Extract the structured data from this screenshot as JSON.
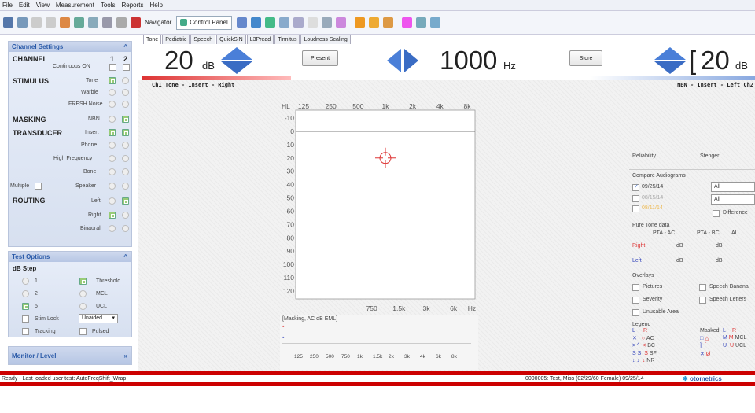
{
  "menu": [
    "File",
    "Edit",
    "View",
    "Measurement",
    "Tools",
    "Reports",
    "Help"
  ],
  "toolbar": {
    "navigator_label": "Navigator",
    "control_panel_label": "Control Panel"
  },
  "tabs": [
    "Tone",
    "Pediatric",
    "Speech",
    "QuickSIN",
    "L3Pread",
    "Tinnitus",
    "Loudness Scaling"
  ],
  "channel_settings": {
    "title": "Channel Settings",
    "channel_label": "CHANNEL",
    "ch1": "1",
    "ch2": "2",
    "continuous_on": "Continuous ON",
    "stimulus_label": "STIMULUS",
    "tone": "Tone",
    "warble": "Warble",
    "fresh_noise": "FRESH Noise",
    "masking_label": "MASKING",
    "nbn": "NBN",
    "transducer_label": "TRANSDUCER",
    "insert": "Insert",
    "phone": "Phone",
    "high_frequency": "High Frequency",
    "bone": "Bone",
    "multiple": "Multiple",
    "speaker": "Speaker",
    "routing_label": "ROUTING",
    "left": "Left",
    "right": "Right",
    "binaural": "Binaural"
  },
  "test_options": {
    "title": "Test Options",
    "db_step_label": "dB Step",
    "step1": "1",
    "step2": "2",
    "step5": "5",
    "threshold": "Threshold",
    "mcl": "MCL",
    "ucl": "UCL",
    "stim_lock": "Stim Lock",
    "aided_value": "Unaided",
    "tracking": "Tracking",
    "pulsed": "Pulsed"
  },
  "monitor": {
    "title": "Monitor / Level"
  },
  "controls": {
    "left_level": "20",
    "left_unit": "dB",
    "present_label": "Present",
    "frequency": "1000",
    "frequency_unit": "Hz",
    "store_label": "Store",
    "right_level": "20",
    "right_unit": "dB",
    "ch1_info": "Ch1 Tone - Insert - Right",
    "ch2_info": "NBN - Insert - Left Ch2"
  },
  "audiogram": {
    "hl_label": "HL",
    "top_freqs": [
      "125",
      "250",
      "500",
      "1k",
      "2k",
      "4k",
      "8k"
    ],
    "bottom_freqs": [
      "750",
      "1.5k",
      "3k",
      "6k"
    ],
    "hz_label": "Hz",
    "levels": [
      "-10",
      "0",
      "10",
      "20",
      "30",
      "40",
      "50",
      "60",
      "70",
      "80",
      "90",
      "100",
      "110",
      "120"
    ]
  },
  "chart_data": {
    "type": "scatter",
    "xlabel": "Hz",
    "ylabel": "HL",
    "ylim": [
      -10,
      120
    ],
    "x_ticks": [
      "125",
      "250",
      "500",
      "1k",
      "2k",
      "4k",
      "8k"
    ],
    "series": [
      {
        "name": "",
        "points": [
          {
            "x": "1k",
            "y": 20
          }
        ],
        "color": "#d33"
      }
    ]
  },
  "masking_panel": {
    "title": "[Masking, AC dB EML]",
    "freqs": [
      "125",
      "250",
      "500",
      "750",
      "1k",
      "1.5k",
      "2k",
      "3k",
      "4k",
      "6k",
      "8k"
    ]
  },
  "right_panel": {
    "reliability": "Reliability",
    "stenger": "Stenger",
    "compare_title": "Compare Audiograms",
    "date1": "09/25/14",
    "date2": "08/15/14",
    "date3": "08/11/14",
    "all1": "All",
    "all2": "All",
    "difference": "Difference",
    "pure_tone_title": "Pure Tone data",
    "pta_ac": "PTA - AC",
    "pta_bc": "PTA - BC",
    "ai": "AI",
    "right": "Right",
    "left": "Left",
    "db": "dB",
    "overlays": "Overlays",
    "pictures": "Pictures",
    "speech_banana": "Speech Banana",
    "severity": "Severity",
    "speech_letters": "Speech Letters",
    "unusable_area": "Unusable Area",
    "legend": "Legend",
    "masked": "Masked",
    "legend_l": "L",
    "legend_r": "R",
    "ac": "AC",
    "bc": "BC",
    "sf": "SF",
    "nr": "NR",
    "mcl": "MCL",
    "ucl": "UCL"
  },
  "status": {
    "left_text": "Ready - Last loaded user test: AutoFreqShift_Wrap",
    "right_text": "0000005: Test, Miss (02/29/60 Female) 09/25/14",
    "brand": "otometrics"
  },
  "colors": {
    "accent": "#2a5aa8",
    "red": "#d33",
    "blue": "#34b",
    "status_bar": "#c00"
  }
}
